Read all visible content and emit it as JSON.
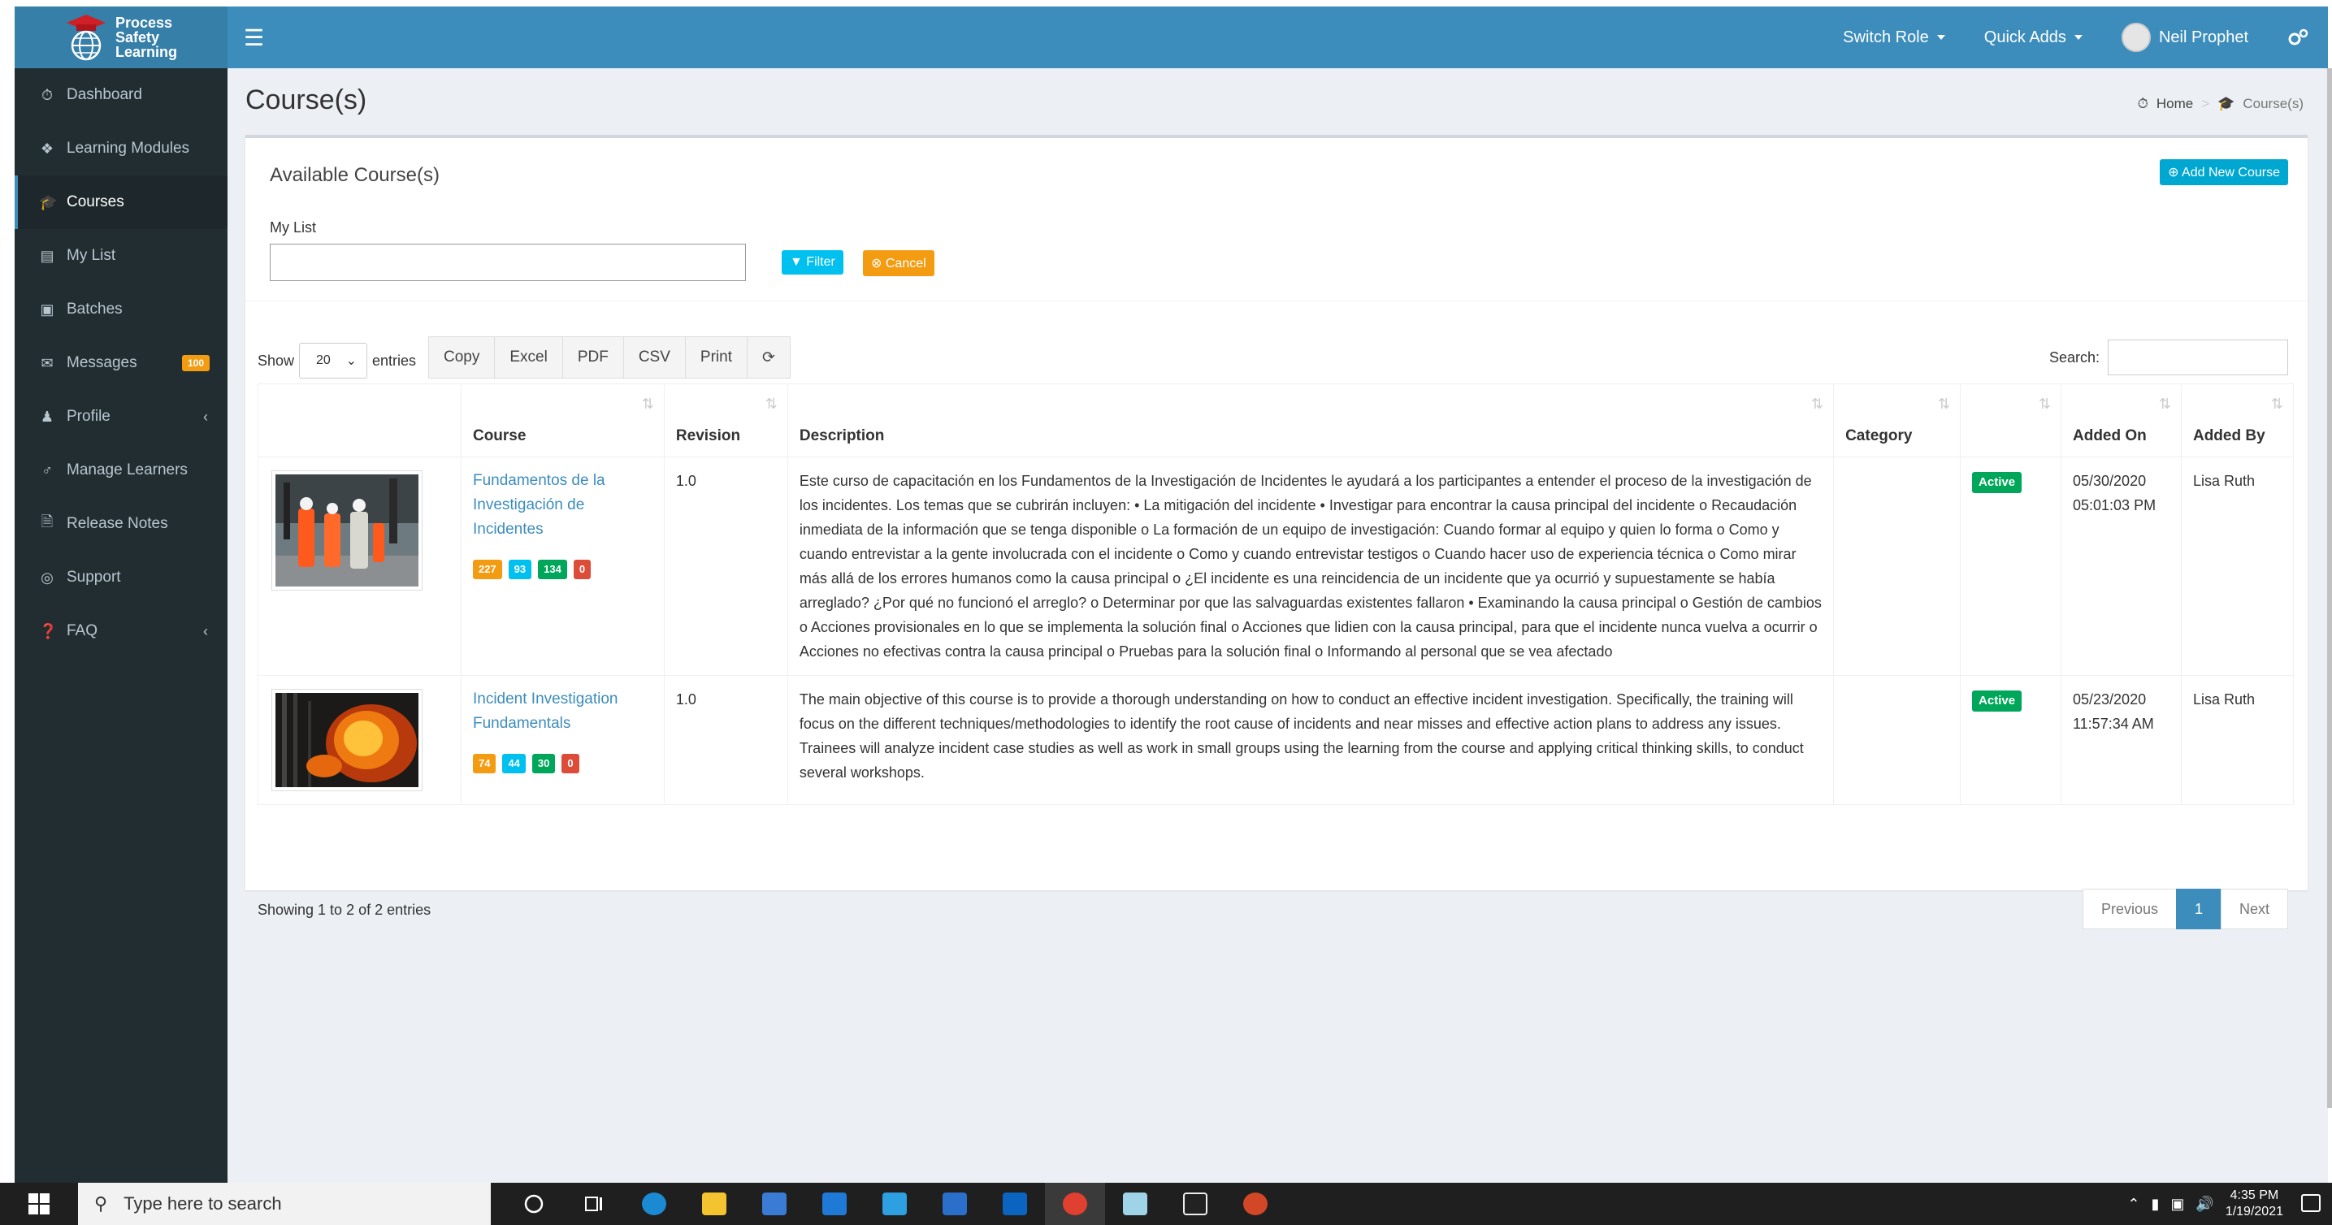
{
  "brand": {
    "line1": "Process",
    "line2": "Safety",
    "line3": "Learning"
  },
  "header": {
    "switch_role": "Switch Role",
    "quick_adds": "Quick Adds",
    "user_name": "Neil Prophet"
  },
  "sidebar": {
    "items": [
      {
        "label": "Dashboard",
        "icon": "dashboard-icon"
      },
      {
        "label": "Learning Modules",
        "icon": "puzzle-icon"
      },
      {
        "label": "Courses",
        "icon": "graduation-cap-icon",
        "active": true
      },
      {
        "label": "My List",
        "icon": "list-icon"
      },
      {
        "label": "Batches",
        "icon": "object-group-icon"
      },
      {
        "label": "Messages",
        "icon": "envelope-icon",
        "badge": "100"
      },
      {
        "label": "Profile",
        "icon": "user-icon",
        "chevron": true
      },
      {
        "label": "Manage Learners",
        "icon": "male-icon"
      },
      {
        "label": "Release Notes",
        "icon": "file-icon"
      },
      {
        "label": "Support",
        "icon": "life-ring-icon"
      },
      {
        "label": "FAQ",
        "icon": "question-circle-icon",
        "chevron": true
      }
    ]
  },
  "page": {
    "title": "Course(s)",
    "breadcrumb": {
      "home": "Home",
      "current": "Course(s)"
    }
  },
  "box": {
    "title": "Available Course(s)",
    "add_button": "Add New Course",
    "mylist_label": "My List",
    "mylist_value": "",
    "filter_button": "Filter",
    "cancel_button": "Cancel"
  },
  "table_controls": {
    "show_label": "Show",
    "page_size": "20",
    "entries_label": "entries",
    "buttons": [
      "Copy",
      "Excel",
      "PDF",
      "CSV",
      "Print"
    ],
    "search_label": "Search:",
    "search_value": ""
  },
  "table": {
    "columns": [
      "",
      "Course",
      "Revision",
      "Description",
      "Category",
      "",
      "Added On",
      "Added By"
    ],
    "rows": [
      {
        "course": "Fundamentos de la Investigación de Incidentes",
        "counts": [
          "227",
          "93",
          "134",
          "0"
        ],
        "revision": "1.0",
        "description": "Este curso de capacitación en los Fundamentos de la Investigación de Incidentes le ayudará a los participantes a entender el proceso de la investigación de los incidentes. Los temas que se cubrirán incluyen: • La mitigación del incidente • Investigar para encontrar la causa principal del incidente o Recaudación inmediata de la información que se tenga disponible o La formación de un equipo de investigación: Cuando formar al equipo y quien lo forma o Como y cuando entrevistar a la gente involucrada con el incidente o Como y cuando entrevistar testigos o Cuando hacer uso de experiencia técnica o Como mirar más allá de los errores humanos como la causa principal o ¿El incidente es una reincidencia de un incidente que ya ocurrió y supuestamente se había arreglado? ¿Por qué no funcionó el arreglo? o Determinar por que las salvaguardas existentes fallaron • Examinando la causa principal o Gestión de cambios o Acciones provisionales en lo que se implementa la solución final o Acciones que lidien con la causa principal, para que el incidente nunca vuelva a ocurrir o Acciones no efectivas contra la causa principal o Pruebas para la solución final o Informando al personal que se vea afectado",
        "category": "",
        "status": "Active",
        "added_date": "05/30/2020",
        "added_time": "05:01:03 PM",
        "added_by": "Lisa Ruth"
      },
      {
        "course": "Incident Investigation Fundamentals",
        "counts": [
          "74",
          "44",
          "30",
          "0"
        ],
        "revision": "1.0",
        "description": "The main objective of this course is to provide a thorough understanding on how to conduct an effective incident investigation. Specifically, the training will focus on the different techniques/methodologies to identify the root cause of incidents and near misses and effective action plans to address any issues. Trainees will analyze incident case studies as well as work in small groups using the learning from the course and applying critical thinking skills, to conduct several workshops.",
        "category": "",
        "status": "Active",
        "added_date": "05/23/2020",
        "added_time": "11:57:34 AM",
        "added_by": "Lisa Ruth"
      }
    ]
  },
  "footer": {
    "showing": "Showing 1 to 2 of 2 entries",
    "previous": "Previous",
    "current_page": "1",
    "next": "Next"
  },
  "taskbar": {
    "search_placeholder": "Type here to search",
    "time": "4:35 PM",
    "date": "1/19/2021"
  }
}
